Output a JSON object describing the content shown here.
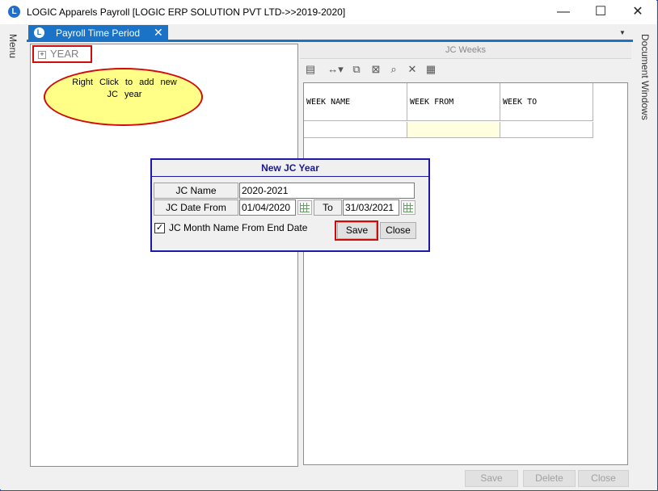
{
  "window": {
    "title": "LOGIC Apparels Payroll  [LOGIC ERP SOLUTION PVT LTD->>2019-2020]",
    "app_icon": "L",
    "minimize": "—",
    "maximize": "☐",
    "close": "✕"
  },
  "sidebars": {
    "left_label": "Menu",
    "right_label": "Document Windows"
  },
  "doc_tab": {
    "label": "Payroll Time Period",
    "close": "✕",
    "overflow": "▼"
  },
  "tree": {
    "expander": "+",
    "root_label": "YEAR"
  },
  "callout": {
    "text": "Right Click to add new JC year"
  },
  "jc_weeks": {
    "header": "JC Weeks",
    "toolbar_icons": [
      "grid-settings-icon",
      "column-width-icon",
      "copy-icon",
      "delete-grid-icon",
      "find-icon",
      "clear-icon",
      "table-icon"
    ],
    "columns": [
      "WEEK NAME",
      "WEEK FROM",
      "WEEK TO"
    ],
    "rows": [
      [
        "",
        "",
        ""
      ]
    ]
  },
  "dialog": {
    "title": "New JC Year",
    "jc_name_label": "JC Name",
    "jc_name_value": "2020-2021",
    "date_from_label": "JC Date From",
    "date_from_value": "01/04/2020",
    "to_label": "To",
    "date_to_value": "31/03/2021",
    "checkbox_label": "JC Month Name From End Date",
    "checkbox_checked": true,
    "save_label": "Save",
    "close_label": "Close"
  },
  "footer": {
    "save_label": "Save",
    "delete_label": "Delete",
    "close_label": "Close"
  },
  "colors": {
    "accent_blue": "#1a73c7",
    "highlight_red": "#d20a0a",
    "callout_fill": "#ffff88",
    "dialog_border": "#1a1aa6"
  }
}
